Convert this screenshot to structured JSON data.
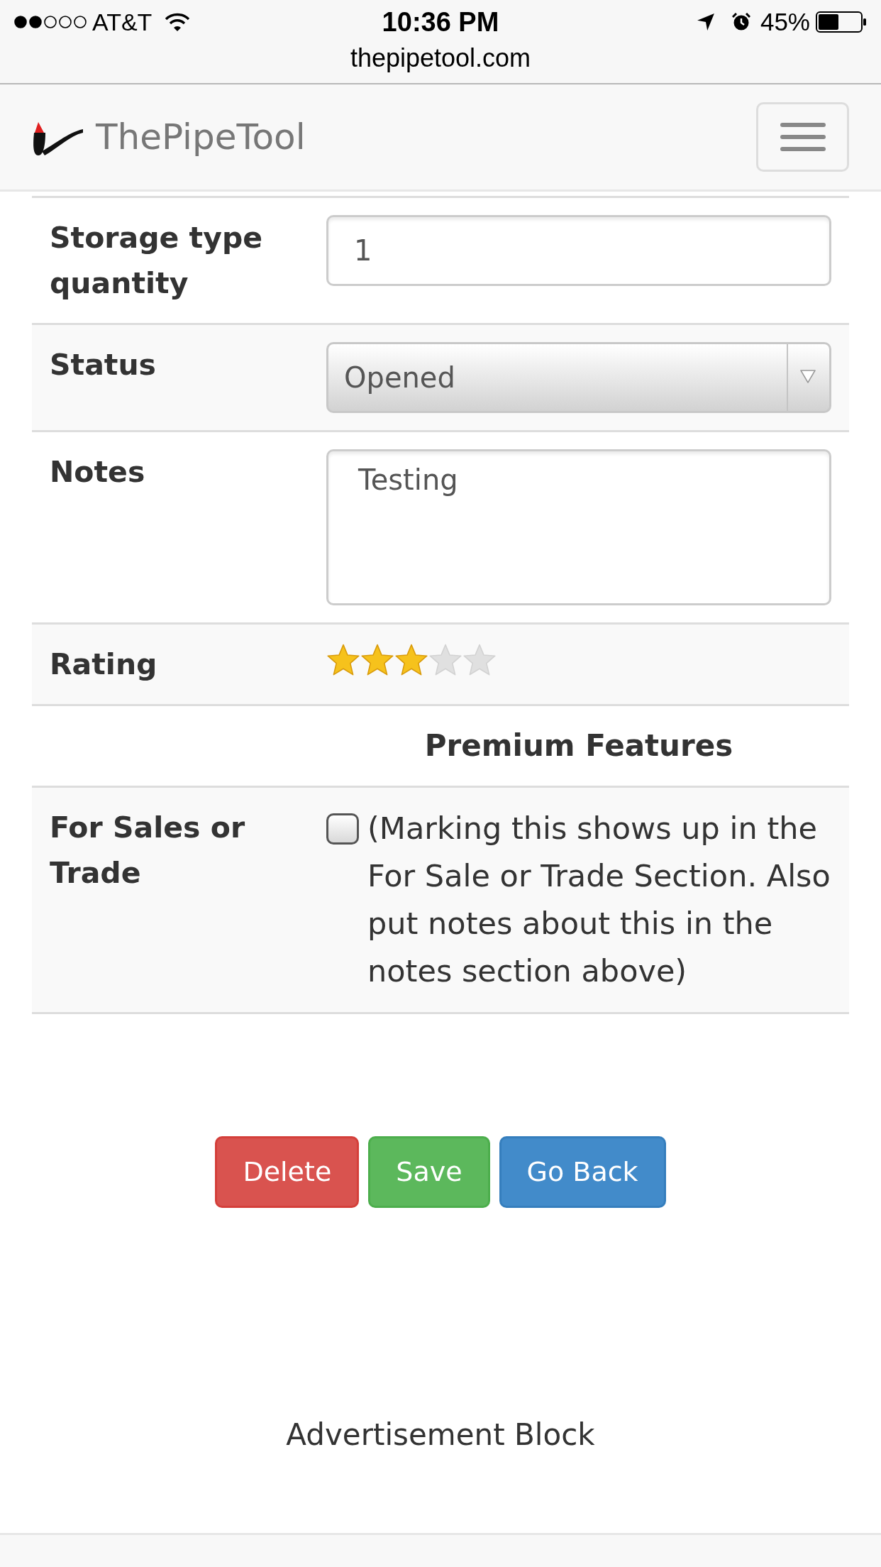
{
  "status_bar": {
    "carrier": "AT&T",
    "time": "10:36 PM",
    "battery": "45%",
    "url": "thepipetool.com"
  },
  "navbar": {
    "brand": "ThePipeTool"
  },
  "form": {
    "rows": [
      {
        "kind": "input",
        "label": "Storage type quantity",
        "value": "1"
      },
      {
        "kind": "select",
        "label": "Status",
        "value": "Opened"
      },
      {
        "kind": "textarea",
        "label": "Notes",
        "value": "Testing"
      },
      {
        "kind": "rating",
        "label": "Rating",
        "stars": 3
      },
      {
        "kind": "heading",
        "text": "Premium Features"
      },
      {
        "kind": "checkbox",
        "label": "For Sales or Trade",
        "checked": false,
        "text": "(Marking this shows up in the For Sale or Trade Section. Also put notes about this in the notes section above)"
      }
    ]
  },
  "buttons": [
    {
      "kind": "danger",
      "label": "Delete"
    },
    {
      "kind": "success",
      "label": "Save"
    },
    {
      "kind": "primary",
      "label": "Go Back"
    }
  ],
  "advertisement": {
    "text": "Advertisement Block"
  }
}
